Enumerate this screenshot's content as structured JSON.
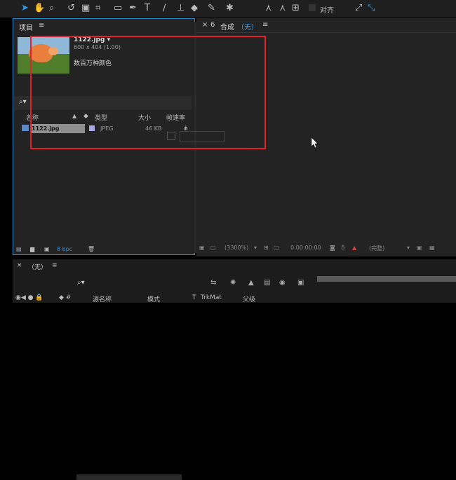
{
  "toolbar": {
    "icons": [
      "select-tool-icon",
      "hand-tool-icon",
      "zoom-tool-icon",
      "rotate-tool-icon",
      "camera-tool-icon",
      "pan-behind-icon",
      "rect-tool-icon",
      "pen-tool-icon",
      "type-tool-icon",
      "brush-tool-icon",
      "stamp-tool-icon",
      "eraser-tool-icon",
      "roto-brush-icon",
      "puppet-tool-icon"
    ],
    "align_label": "对齐"
  },
  "project": {
    "tab_label": "项目",
    "menu_glyph": "≡",
    "file_name": "1122.jpg ▾",
    "file_dims": "600 x 404 (1.00)",
    "file_colors": "数百万种颜色",
    "search_glyph": "⌕▾",
    "columns": {
      "name": "名称",
      "type": "类型",
      "size": "大小",
      "rate": "帧速率"
    },
    "row": {
      "name": "1122.jpg",
      "type": "JPEG",
      "size": "46 KB"
    },
    "bpc": "8 bpc"
  },
  "comp": {
    "close": "×",
    "tab_label": "合成",
    "tab_value": "（无）",
    "menu_glyph": "≡",
    "zoom": "(3300%)",
    "timecode": "0:00:00:00",
    "quality": "(完整)"
  },
  "timeline": {
    "close": "×",
    "title": "（无）",
    "menu_glyph": "≡",
    "columns": {
      "source_name": "源名称",
      "mode": "模式",
      "t": "T",
      "trkmat": "TrkMat",
      "parent": "父级"
    }
  },
  "colors": {
    "highlight": "#e0202a",
    "panel_border": "#2f86c9"
  }
}
